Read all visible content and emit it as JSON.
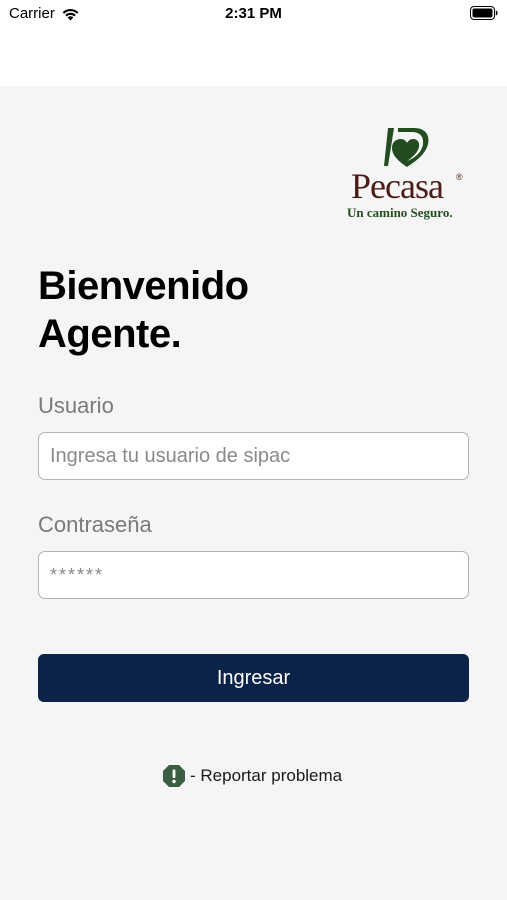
{
  "status_bar": {
    "carrier": "Carrier",
    "time": "2:31 PM",
    "wifi_icon": "wifi-icon",
    "battery_icon": "battery-icon"
  },
  "logo": {
    "wordmark": "Pecasa",
    "registered": "®",
    "tagline": "Un camino Seguro.",
    "mark_color": "#234d20",
    "word_color": "#4a1e17"
  },
  "login": {
    "title_line1": "Bienvenido",
    "title_line2": "Agente.",
    "user_label": "Usuario",
    "user_placeholder": "Ingresa tu usuario de sipac",
    "user_value": "",
    "password_label": "Contraseña",
    "password_placeholder": "******",
    "password_value": "",
    "submit_label": "Ingresar",
    "submit_color": "#0b2249"
  },
  "report": {
    "label": "- Reportar problema",
    "icon": "alert-icon",
    "icon_color": "#3c5e43"
  }
}
